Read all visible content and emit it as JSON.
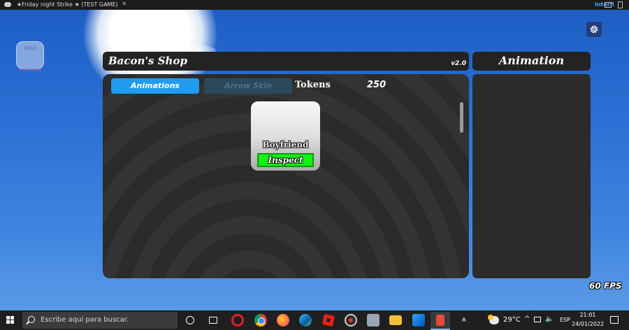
{
  "window": {
    "title": "★Friday night Strike ★ (TEST GAME)",
    "more": "···",
    "close": "✕",
    "right_label": "Interfi"
  },
  "game": {
    "back_label": "Back",
    "shop": {
      "title": "Bacon's Shop",
      "version": "v2.0",
      "tabs": [
        {
          "label": "Animations",
          "active": true
        },
        {
          "label": "Arrow Skin",
          "active": false
        }
      ],
      "tokens_label": "Tokens",
      "tokens_value": "250",
      "items": [
        {
          "name": "Boyfriend",
          "action": "Inspect"
        }
      ]
    },
    "animation_panel": {
      "title": "Animation"
    },
    "fps": "60 FPS",
    "colors": {
      "active_tab": "#1f9cf0",
      "inspect_button": "#11f311",
      "panel": "#2b2b2b"
    }
  },
  "taskbar": {
    "search_placeholder": "Escribe aquí para buscar.",
    "apps": [
      "task-view",
      "widgets",
      "opera",
      "chrome",
      "firefox",
      "edge",
      "roblox",
      "obs",
      "roblox-studio",
      "file-explorer",
      "microsoft-store",
      "roblox-game"
    ],
    "tray": {
      "temperature": "29°C",
      "language": "ESP",
      "time": "21:01",
      "date": "24/01/2022",
      "chevron": "^",
      "people_icon": "ጸ",
      "volume_icon": "🔈"
    }
  }
}
